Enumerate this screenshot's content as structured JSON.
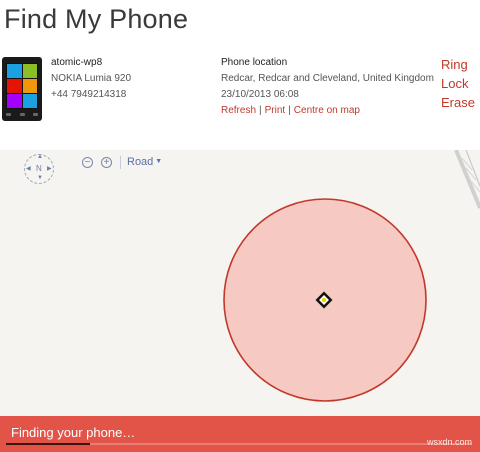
{
  "page": {
    "title": "Find My Phone"
  },
  "device": {
    "name": "atomic-wp8",
    "model": "NOKIA Lumia 920",
    "number": "+44 7949214318",
    "tile_colors": [
      "#1aa1e1",
      "#8cbf26",
      "#e51400",
      "#f09609",
      "#a200ff",
      "#1aa1e1"
    ]
  },
  "location": {
    "heading": "Phone location",
    "address": "Redcar, Redcar and Cleveland, United Kingdom",
    "timestamp": "23/10/2013 06:08",
    "links": {
      "refresh": "Refresh",
      "print": "Print",
      "centre": "Centre on map",
      "separator": "|"
    }
  },
  "actions": {
    "ring": "Ring",
    "lock": "Lock",
    "erase": "Erase"
  },
  "map": {
    "compass": {
      "north": "N"
    },
    "zoom_out": "−",
    "zoom_in": "+",
    "view_type": "Road",
    "accuracy_fill": "#f6c9c2",
    "accuracy_stroke": "#c0392b",
    "marker_color": "#f2d300",
    "icons": [
      "compass-icon",
      "zoom-out-icon",
      "zoom-in-icon",
      "caret-down-icon",
      "location-marker-icon"
    ]
  },
  "status": {
    "message": "Finding your phone…",
    "progress": 0.18,
    "bar_color": "#e25448",
    "watermark": "wsxdn.com"
  }
}
